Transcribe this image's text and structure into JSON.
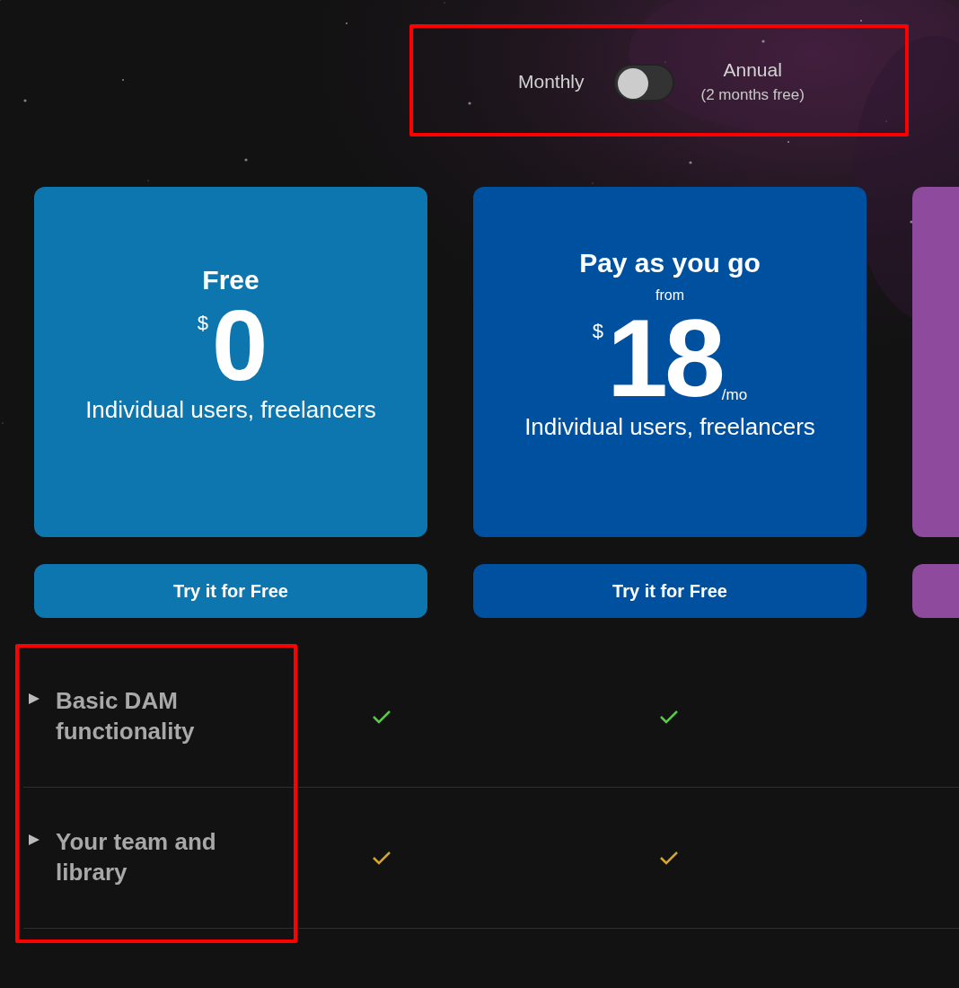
{
  "billing_toggle": {
    "left_label": "Monthly",
    "on": false,
    "right_label": "Annual",
    "right_note": "(2 months free)"
  },
  "plans": [
    {
      "name": "Free",
      "currency": "$",
      "price": "0",
      "audience": "Individual users, freelancers",
      "button": "Try it for Free",
      "color": "#0e76ae"
    },
    {
      "name": "Pay as you go",
      "from": "from",
      "currency": "$",
      "price": "18",
      "period": "/mo",
      "audience": "Individual users, freelancers",
      "button": "Try it for Free",
      "color": "#0050a0"
    },
    {
      "color": "#8e4a9c"
    }
  ],
  "features": [
    {
      "label": "Basic DAM functionality",
      "expanded": false,
      "checks": [
        {
          "color": "#5cc84a"
        },
        {
          "color": "#5cc84a"
        }
      ]
    },
    {
      "label": "Your team and library",
      "expanded": false,
      "checks": [
        {
          "color": "#d4a72c"
        },
        {
          "color": "#d4a72c"
        }
      ]
    }
  ]
}
